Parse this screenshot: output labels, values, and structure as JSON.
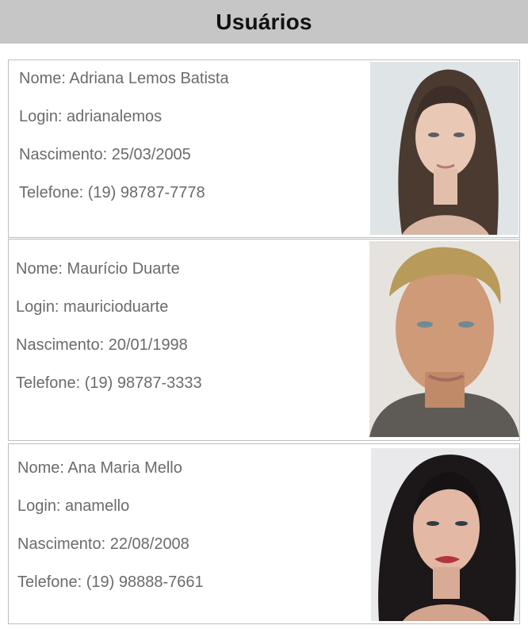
{
  "header": {
    "title": "Usuários"
  },
  "users": [
    {
      "nome": "Nome: Adriana Lemos Batista",
      "login": "Login: adrianalemos",
      "nascimento": "Nascimento: 25/03/2005",
      "telefone": "Telefone: (19) 98787-7778",
      "photo_icon": "user-photo"
    },
    {
      "nome": "Nome: Maurício Duarte",
      "login": "Login: mauricioduarte",
      "nascimento": "Nascimento: 20/01/1998",
      "telefone": "Telefone: (19) 98787-3333",
      "photo_icon": "user-photo"
    },
    {
      "nome": "Nome: Ana Maria Mello",
      "login": "Login: anamello",
      "nascimento": "Nascimento: 22/08/2008",
      "telefone": "Telefone: (19) 98888-7661",
      "photo_icon": "user-photo"
    }
  ],
  "colors": {
    "header_bg": "#c6c6c6",
    "text": "#6b6b6b",
    "border": "#bdbdbd"
  }
}
